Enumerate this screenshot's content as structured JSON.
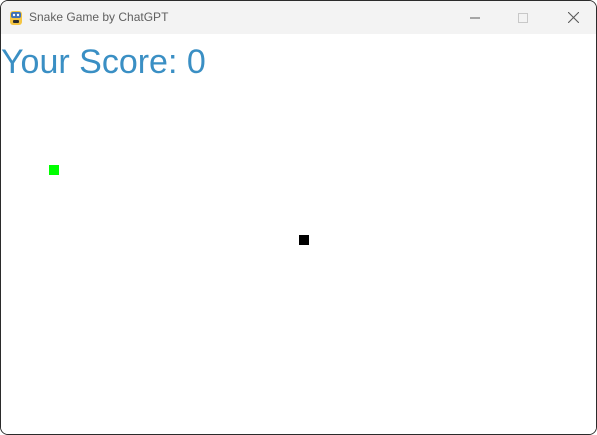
{
  "window": {
    "title": "Snake Game by ChatGPT"
  },
  "score": {
    "label": "Your Score: 0",
    "value": 0,
    "color": "#3a8fc4"
  },
  "game": {
    "food": {
      "color": "#00ff00"
    },
    "snake": {
      "color": "#000000",
      "length": 1
    },
    "background": "#ffffff"
  },
  "controls": {
    "minimize_icon": "minimize-icon",
    "maximize_icon": "maximize-icon",
    "close_icon": "close-icon"
  }
}
